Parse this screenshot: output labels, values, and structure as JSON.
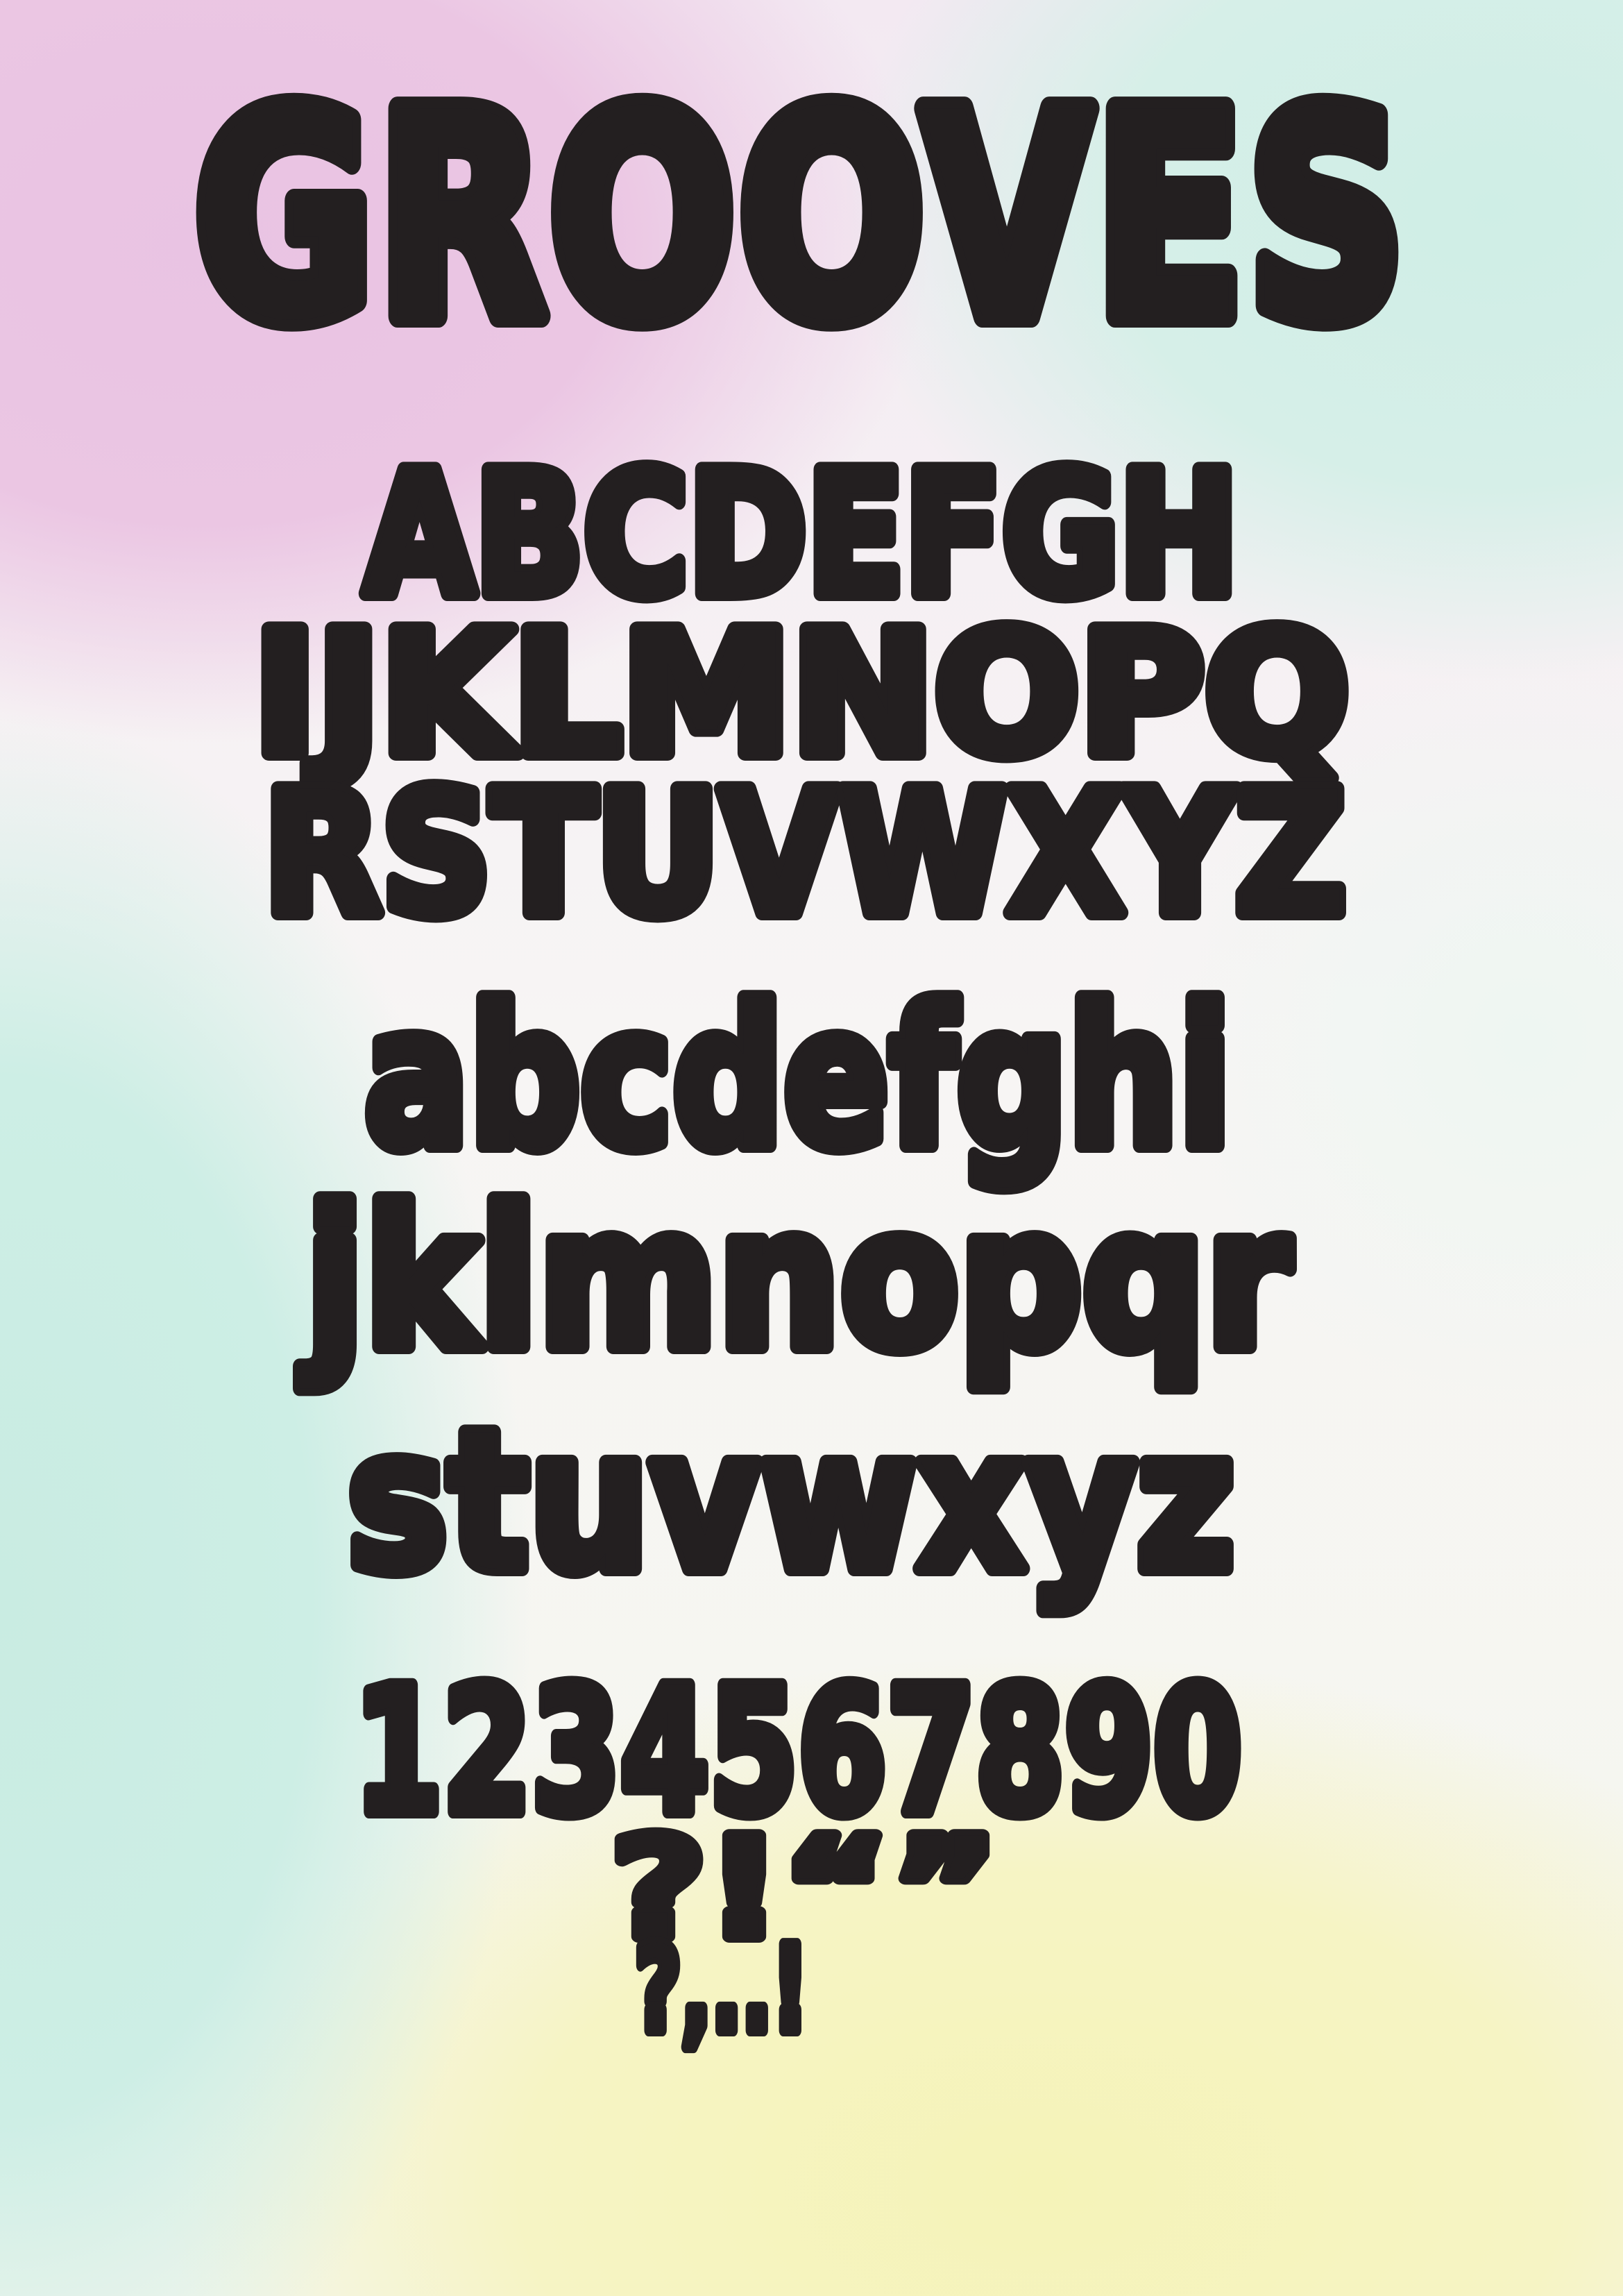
{
  "title": "GROOVES",
  "uppercase": [
    "ABCDEFGH",
    "IJKLMNOPQ",
    "RSTUVWXYZ"
  ],
  "lowercase": [
    "abcdefghi",
    "jklmnopqr",
    "stuvwxyz"
  ],
  "numerals": "1234567890",
  "punctuation": [
    "?!“”",
    "?,..!"
  ],
  "colors": {
    "ink": "#231f20",
    "pink": "#ebc6e3",
    "mint": "#cdeee5",
    "yellow": "#f6f4c4"
  }
}
